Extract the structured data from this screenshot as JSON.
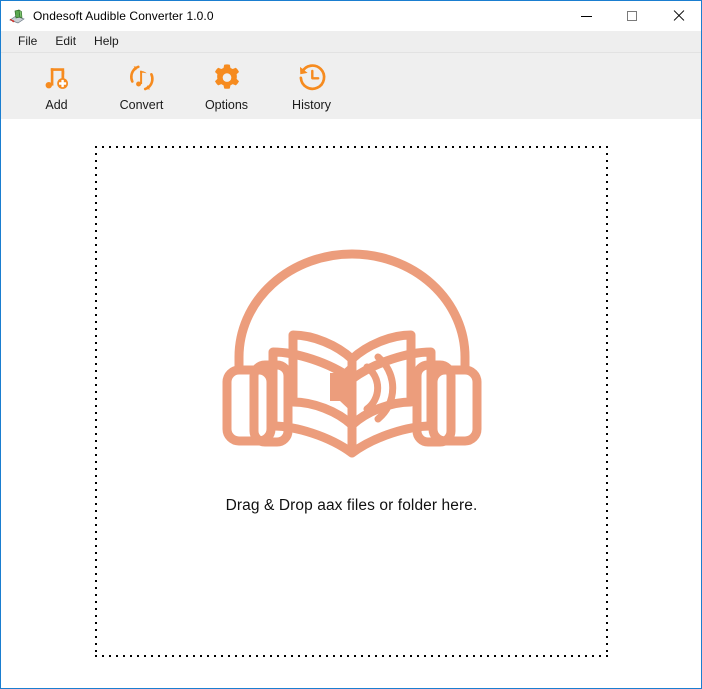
{
  "window": {
    "title": "Ondesoft Audible Converter 1.0.0",
    "app_icon": "app-logo-icon",
    "controls": [
      {
        "name": "minimize-button",
        "icon": "minimize-icon",
        "label": "Minimize"
      },
      {
        "name": "maximize-button",
        "icon": "maximize-icon",
        "label": "Maximize"
      },
      {
        "name": "close-button",
        "icon": "close-icon",
        "label": "Close"
      }
    ],
    "border_color": "#1a7ed0"
  },
  "menubar": {
    "items": [
      {
        "label": "File"
      },
      {
        "label": "Edit"
      },
      {
        "label": "Help"
      }
    ]
  },
  "toolbar": {
    "accent_color": "#F68B1F",
    "buttons": [
      {
        "label": "Add",
        "icon": "music-note-add-icon"
      },
      {
        "label": "Convert",
        "icon": "convert-circular-arrows-note-icon"
      },
      {
        "label": "Options",
        "icon": "gear-icon"
      },
      {
        "label": "History",
        "icon": "clock-history-icon"
      }
    ]
  },
  "main": {
    "dropzone": {
      "illustration_icon": "audiobook-headphones-book-speaker-icon",
      "illustration_color": "#EC9D7C",
      "text": "Drag & Drop aax files or folder here.",
      "border_style": "dotted"
    }
  }
}
